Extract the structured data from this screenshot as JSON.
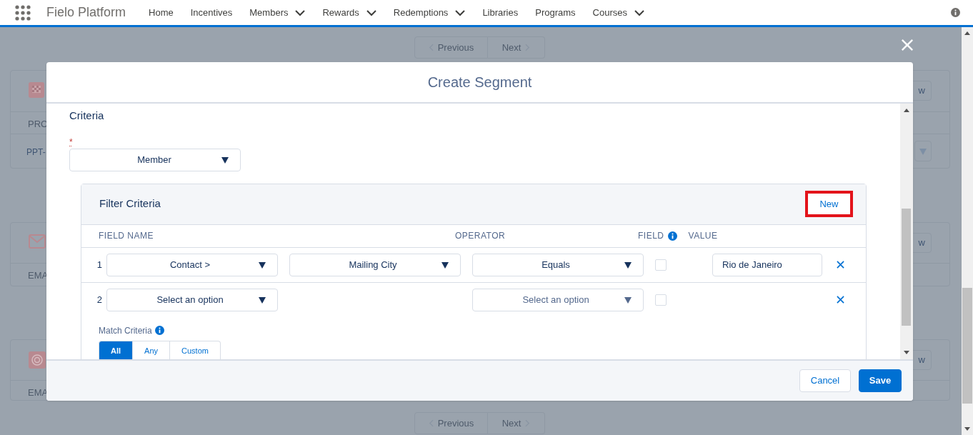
{
  "app": {
    "name": "Fielo Platform",
    "nav": [
      {
        "label": "Home",
        "has_menu": false
      },
      {
        "label": "Incentives",
        "has_menu": false
      },
      {
        "label": "Members",
        "has_menu": true
      },
      {
        "label": "Rewards",
        "has_menu": true
      },
      {
        "label": "Redemptions",
        "has_menu": true
      },
      {
        "label": "Libraries",
        "has_menu": false
      },
      {
        "label": "Programs",
        "has_menu": false
      },
      {
        "label": "Courses",
        "has_menu": true
      }
    ]
  },
  "background": {
    "pagination_top": [
      "Previous",
      "Next"
    ],
    "cards": [
      {
        "label": "PRO",
        "value": "PPT-",
        "button": "w",
        "has_dropdown": true
      },
      {
        "label": "EMA",
        "button": "w",
        "has_dropdown": false
      },
      {
        "label": "EMA",
        "button": "w",
        "has_dropdown": false
      }
    ],
    "pagination_bottom": [
      "Previous",
      "Next"
    ]
  },
  "modal": {
    "title": "Create Segment",
    "section_title": "Criteria",
    "required_mark": "*",
    "object_select": {
      "value": "Member"
    },
    "filter": {
      "title": "Filter Criteria",
      "new_button": "New",
      "columns": [
        "FIELD NAME",
        "OPERATOR",
        "FIELD",
        "VALUE"
      ],
      "rows": [
        {
          "number": "1",
          "fields": [
            "Contact >",
            "Mailing City"
          ],
          "operator": {
            "text": "Equals",
            "placeholder": false
          },
          "field_checked": false,
          "value": "Rio de Janeiro"
        },
        {
          "number": "2",
          "fields": [
            "Select an option"
          ],
          "operator": {
            "text": "Select an option",
            "placeholder": true
          },
          "field_checked": false
        }
      ],
      "match_criteria": {
        "label": "Match Criteria",
        "options": [
          {
            "label": "All",
            "selected": true
          },
          {
            "label": "Any",
            "selected": false
          },
          {
            "label": "Custom",
            "selected": false
          }
        ]
      }
    },
    "buttons": [
      {
        "label": "Cancel",
        "kind": "neutral"
      },
      {
        "label": "Save",
        "kind": "brand"
      }
    ]
  }
}
